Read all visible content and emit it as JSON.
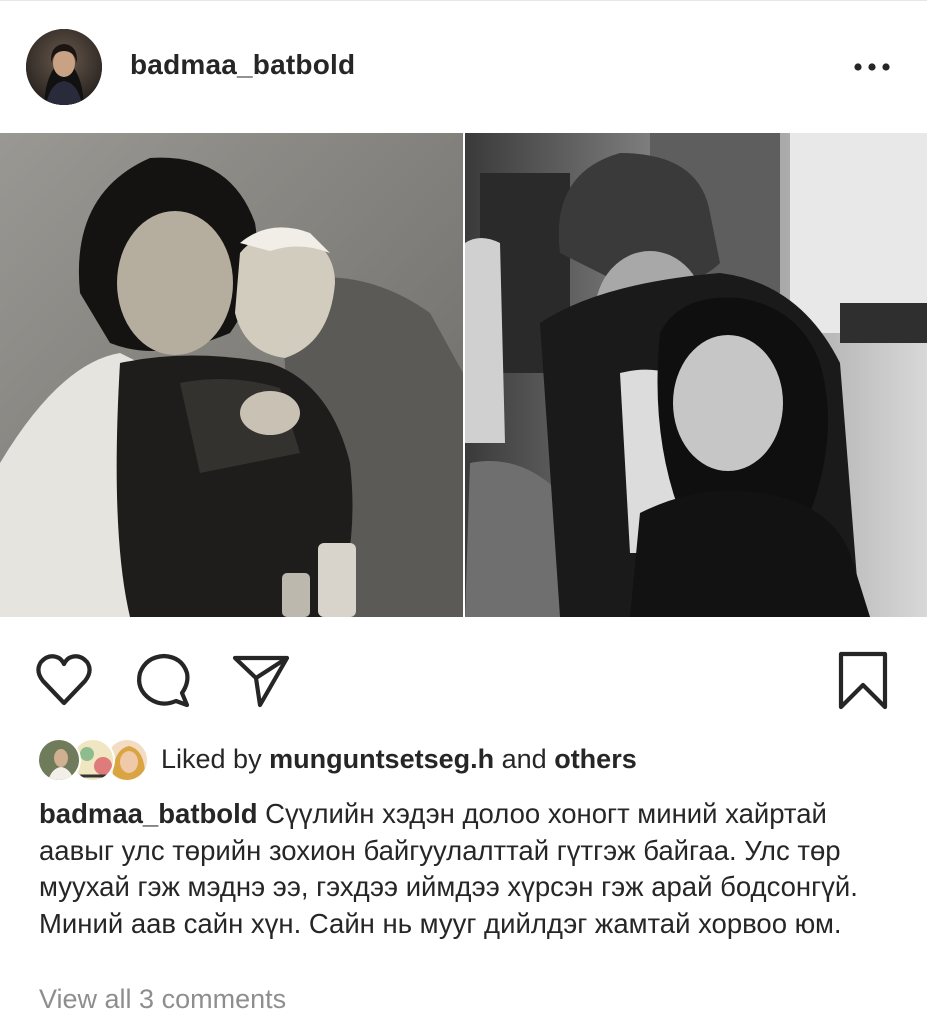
{
  "post": {
    "username": "badmaa_batbold",
    "more_icon": "more-horizontal-icon",
    "photo_left_desc": "",
    "photo_right_desc": ""
  },
  "actions": {
    "like_icon": "heart-icon",
    "comment_icon": "comment-icon",
    "share_icon": "send-icon",
    "save_icon": "bookmark-icon"
  },
  "likes": {
    "prefix": "Liked by",
    "user": "munguntsetseg.h",
    "and": "and",
    "others": "others"
  },
  "caption": {
    "username": "badmaa_batbold",
    "text": "Сүүлийн хэдэн долоо хоногт миний хайртай аавыг улс төрийн зохион байгуулалттай гүтгэж байгаа. Улс төр муухай гэж мэднэ ээ, гэхдээ иймдээ хүрсэн гэж арай бодсонгүй. Миний аав сайн хүн. Сайн нь мууг дийлдэг жамтай хорвоо юм."
  },
  "comments": {
    "view_all": "View all 3 comments"
  }
}
